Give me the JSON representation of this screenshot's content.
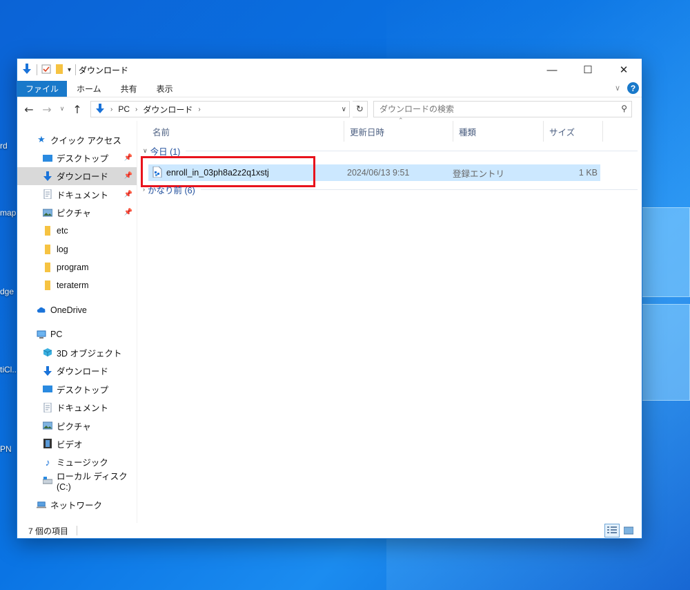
{
  "desktop": {
    "labels": [
      "rd",
      "map",
      "dge",
      "tiCl...",
      "PN"
    ]
  },
  "window": {
    "title": "ダウンロード",
    "controls": {
      "minimize": "—",
      "maximize": "☐",
      "close": "✕"
    }
  },
  "ribbon": {
    "tabs": [
      "ファイル",
      "ホーム",
      "共有",
      "表示"
    ]
  },
  "address": {
    "crumbs": [
      "PC",
      "ダウンロード"
    ],
    "search_placeholder": "ダウンロードの検索"
  },
  "nav": {
    "quick_access": "クイック アクセス",
    "quick_items": [
      {
        "label": "デスクトップ",
        "icon": "desktop-folder-icon",
        "pinned": true
      },
      {
        "label": "ダウンロード",
        "icon": "download-folder-icon",
        "pinned": true,
        "selected": true
      },
      {
        "label": "ドキュメント",
        "icon": "document-folder-icon",
        "pinned": true
      },
      {
        "label": "ピクチャ",
        "icon": "picture-folder-icon",
        "pinned": true
      },
      {
        "label": "etc",
        "icon": "folder-icon"
      },
      {
        "label": "log",
        "icon": "folder-icon"
      },
      {
        "label": "program",
        "icon": "folder-icon"
      },
      {
        "label": "teraterm",
        "icon": "folder-icon"
      }
    ],
    "onedrive": "OneDrive",
    "pc": "PC",
    "pc_items": [
      {
        "label": "3D オブジェクト",
        "icon": "3d-objects-icon"
      },
      {
        "label": "ダウンロード",
        "icon": "download-folder-icon"
      },
      {
        "label": "デスクトップ",
        "icon": "desktop-folder-icon"
      },
      {
        "label": "ドキュメント",
        "icon": "document-folder-icon"
      },
      {
        "label": "ピクチャ",
        "icon": "picture-folder-icon"
      },
      {
        "label": "ビデオ",
        "icon": "video-folder-icon"
      },
      {
        "label": "ミュージック",
        "icon": "music-folder-icon"
      },
      {
        "label": "ローカル ディスク (C:)",
        "icon": "local-disk-icon"
      }
    ],
    "network": "ネットワーク"
  },
  "columns": [
    "名前",
    "更新日時",
    "種類",
    "サイズ"
  ],
  "groups": {
    "today": "今日 (1)",
    "older": "かなり前 (6)"
  },
  "file": {
    "name": "enroll_in_03ph8a2z2q1xstj",
    "modified": "2024/06/13 9:51",
    "type": "登録エントリ",
    "size": "1 KB"
  },
  "status": {
    "item_count": "7 個の項目"
  },
  "colors": {
    "accent": "#1979ca",
    "selection": "#cce8ff",
    "highlight_box": "#e8131c"
  }
}
